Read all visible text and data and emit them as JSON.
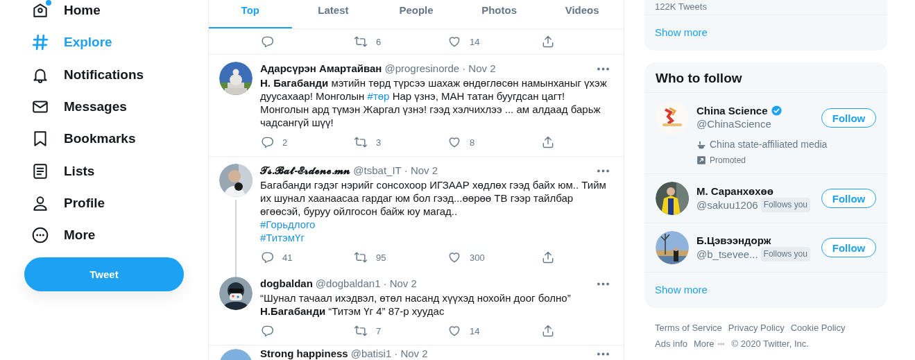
{
  "nav": {
    "items": [
      {
        "label": "Home",
        "selected": false,
        "badge": true
      },
      {
        "label": "Explore",
        "selected": true,
        "badge": false
      },
      {
        "label": "Notifications",
        "selected": false,
        "badge": false
      },
      {
        "label": "Messages",
        "selected": false,
        "badge": false
      },
      {
        "label": "Bookmarks",
        "selected": false,
        "badge": false
      },
      {
        "label": "Lists",
        "selected": false,
        "badge": false
      },
      {
        "label": "Profile",
        "selected": false,
        "badge": false
      },
      {
        "label": "More",
        "selected": false,
        "badge": false
      }
    ],
    "tweet_button": "Tweet"
  },
  "tabs": [
    {
      "label": "Top",
      "selected": true
    },
    {
      "label": "Latest",
      "selected": false
    },
    {
      "label": "People",
      "selected": false
    },
    {
      "label": "Photos",
      "selected": false
    },
    {
      "label": "Videos",
      "selected": false
    }
  ],
  "tweets": [
    {
      "retweets": "6",
      "likes": "14"
    },
    {
      "name": "Адарсүрэн Амартайван",
      "handle": "@progresinorde",
      "time": "· Nov 2",
      "thread": false,
      "text": [
        {
          "kind": "bold",
          "text": "Н. Багабанди"
        },
        {
          "kind": "plain",
          "text": " мэтийн төрд түрсээ шахаж өндөглөсөн намынханыг үхэж дуусахаар! Монголын "
        },
        {
          "kind": "hashtag",
          "text": "#төр"
        },
        {
          "kind": "plain",
          "text": " Нар үзнэ, МАН татан буугдсан цагт! Монголын ард түмэн Жаргал үзнэ! гээд хэлчихлээ ... ам алдаад барьж чадсангүй шүү!"
        }
      ],
      "replies": "2",
      "retweets": "3",
      "likes": "8"
    },
    {
      "name": "𝓣𝓼.𝓑𝓪𝓽-𝓔𝓻𝓭𝓮𝓷𝓮.𝓶𝓷",
      "handle": "@tsbat_IT",
      "time": "· Nov 2",
      "thread": true,
      "text": [
        {
          "kind": "plain",
          "text": "Багабанди гэдэг нэрийг сонсохоор ИГЗААР хөдлөх гээд байх юм.. Тийм их шунал хаанаасаа гардаг юм бол гээд...өөрөө ТВ гээр тайлбар өгөөсэй, буруу ойлгосон байж юу магад..\n"
        },
        {
          "kind": "hashtag",
          "text": "#Горьдлого"
        },
        {
          "kind": "break"
        },
        {
          "kind": "hashtag",
          "text": "#ТитэмҮг"
        }
      ],
      "replies": "41",
      "retweets": "95",
      "likes": "300"
    },
    {
      "name": "dogbaldan",
      "handle": "@dogbaldan1",
      "time": "· Nov 2",
      "thread": false,
      "text": [
        {
          "kind": "plain",
          "text": "“Шунал тачаал ихэдвэл, өтөл насанд хүүхэд нохойн доог болно”\n"
        },
        {
          "kind": "bold",
          "text": "Н.Багабанди"
        },
        {
          "kind": "plain",
          "text": " “Титэм Үг 4” 87-р хуудас"
        }
      ],
      "retweets": "7",
      "likes": "14"
    },
    {
      "name": "Strong happiness",
      "handle": "@batisi1",
      "time": "· Nov 2",
      "thread": false
    }
  ],
  "trends": {
    "count": "122K Tweets",
    "show_more": "Show more"
  },
  "who_to_follow": {
    "title": "Who to follow",
    "accounts": [
      {
        "name": "China Science",
        "handle": "@ChinaScience",
        "verified": true,
        "follows_you": false,
        "label": "China state-affiliated media",
        "promoted": "Promoted",
        "button": "Follow"
      },
      {
        "name": "М. Саранхөхөө",
        "handle": "@sakuu1206",
        "verified": false,
        "follows_you": "Follows you",
        "button": "Follow"
      },
      {
        "name": "Б.Цэвээндорж",
        "handle": "@b_tsevee...",
        "verified": false,
        "follows_you": "Follows you",
        "button": "Follow"
      }
    ],
    "show_more": "Show more"
  },
  "footer": {
    "links": [
      "Terms of Service",
      "Privacy Policy",
      "Cookie Policy",
      "Ads info",
      "More"
    ],
    "copyright": "© 2020 Twitter, Inc."
  }
}
